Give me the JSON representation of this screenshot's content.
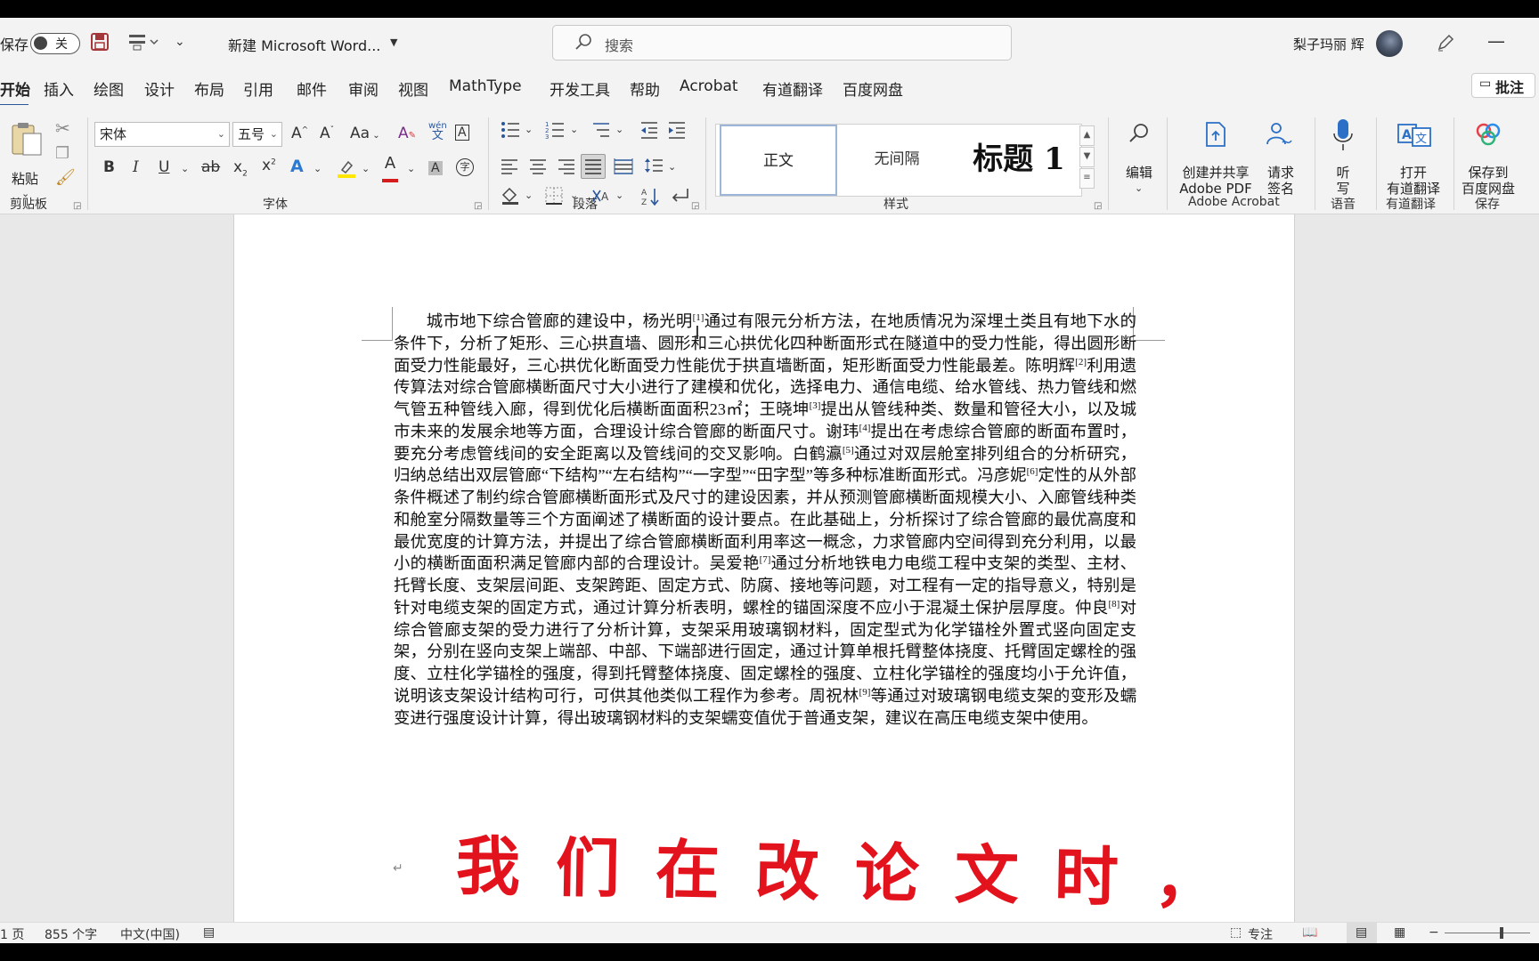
{
  "titlebar": {
    "autosave_label": "保存",
    "autosave_state": "关",
    "doc_title": "新建 Microsoft Word...",
    "search_placeholder": "搜索",
    "user_name": "梨子玛丽 辉"
  },
  "tabs": [
    "开始",
    "插入",
    "绘图",
    "设计",
    "布局",
    "引用",
    "邮件",
    "审阅",
    "视图",
    "MathType",
    "开发工具",
    "帮助",
    "Acrobat",
    "有道翻译",
    "百度网盘"
  ],
  "active_tab": "开始",
  "comment_button": "批注",
  "ribbon": {
    "clipboard": {
      "paste": "粘贴",
      "group": "剪贴板"
    },
    "font": {
      "name": "宋体",
      "size": "五号",
      "case": "Aa",
      "wen": "wén",
      "wen2": "文",
      "group": "字体"
    },
    "paragraph": {
      "group": "段落"
    },
    "styles": {
      "items": [
        "正文",
        "无间隔",
        "标题 1"
      ],
      "group": "样式"
    },
    "editing": {
      "label": "编辑"
    },
    "acrobat": {
      "create_line1": "创建并共享",
      "create_line2": "Adobe PDF",
      "sign_line1": "请求",
      "sign_line2": "签名",
      "group": "Adobe Acrobat"
    },
    "voice": {
      "line1": "听",
      "line2": "写",
      "group": "语音"
    },
    "youdao": {
      "line1": "打开",
      "line2": "有道翻译",
      "group": "有道翻译"
    },
    "baidu": {
      "line1": "保存到",
      "line2": "百度网盘",
      "group": "保存"
    }
  },
  "document": {
    "paragraph": "城市地下综合管廊的建设中，杨光明[1]通过有限元分析方法，在地质情况为深埋土类且有地下水的条件下，分析了矩形、三心拱直墙、圆形和三心拱优化四种断面形式在隧道中的受力性能，得出圆形断面受力性能最好，三心拱优化断面受力性能优于拱直墙断面，矩形断面受力性能最差。陈明辉[2]利用遗传算法对综合管廊横断面尺寸大小进行了建模和优化，选择电力、通信电缆、给水管线、热力管线和燃气管五种管线入廊，得到优化后横断面面积23㎡；王晓坤[3]提出从管线种类、数量和管径大小，以及城市未来的发展余地等方面，合理设计综合管廊的断面尺寸。谢玮[4]提出在考虑综合管廊的断面布置时，要充分考虑管线间的安全距离以及管线间的交叉影响。白鹤瀛[5]通过对双层舱室排列组合的分析研究，归纳总结出双层管廊“下结构”“左右结构”“一字型”“田字型”等多种标准断面形式。冯彦妮[6]定性的从外部条件概述了制约综合管廊横断面形式及尺寸的建设因素，并从预测管廊横断面规模大小、入廊管线种类和舱室分隔数量等三个方面阐述了横断面的设计要点。在此基础上，分析探讨了综合管廊的最优高度和最优宽度的计算方法，并提出了综合管廊横断面利用率这一概念，力求管廊内空间得到充分利用，以最小的横断面面积满足管廊内部的合理设计。吴爱艳[7]通过分析地铁电力电缆工程中支架的类型、主材、托臂长度、支架层间距、支架跨距、固定方式、防腐、接地等问题，对工程有一定的指导意义，特别是针对电缆支架的固定方式，通过计算分析表明，螺栓的锚固深度不应小于混凝土保护层厚度。仲良[8]对综合管廊支架的受力进行了分析计算，支架采用玻璃钢材料，固定型式为化学锚栓外置式竖向固定支架，分别在竖向支架上端部、中部、下端部进行固定，通过计算单根托臂整体挠度、托臂固定螺栓的强度、立柱化学锚栓的强度，得到托臂整体挠度、固定螺栓的强度、立柱化学锚栓的强度均小于允许值，说明该支架设计结构可行，可供其他类似工程作为参考。周祝林[9]等通过对玻璃钢电缆支架的变形及蠕变进行强度设计计算，得出玻璃钢材料的支架蠕变值优于普通支架，建议在高压电缆支架中使用。",
    "paragraph_mark": "↵",
    "overlay_text": "我们在改论文时，"
  },
  "statusbar": {
    "page": "1 页",
    "words": "855 个字",
    "language": "中文(中国)",
    "focus": "专注"
  },
  "colors": {
    "accent": "#2b579a",
    "overlay": "#e3131e",
    "save_icon": "#a4373a"
  }
}
